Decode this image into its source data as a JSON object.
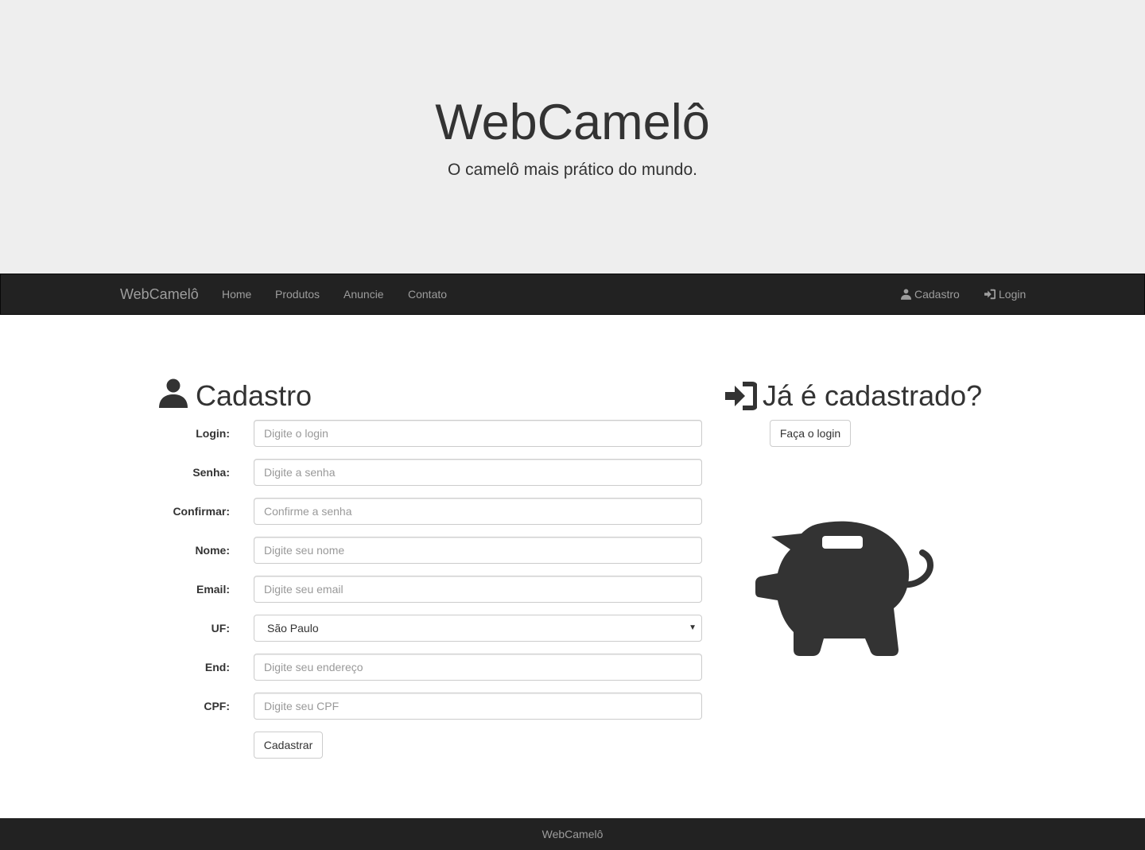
{
  "jumbotron": {
    "title": "WebCamelô",
    "subtitle": "O camelô mais prático do mundo."
  },
  "navbar": {
    "brand": "WebCamelô",
    "links": [
      "Home",
      "Produtos",
      "Anuncie",
      "Contato"
    ],
    "right": {
      "cadastro": "Cadastro",
      "login": "Login"
    }
  },
  "cadastro": {
    "title": "Cadastro",
    "fields": {
      "login": {
        "label": "Login:",
        "placeholder": "Digite o login"
      },
      "senha": {
        "label": "Senha:",
        "placeholder": "Digite a senha"
      },
      "confirmar": {
        "label": "Confirmar:",
        "placeholder": "Confirme a senha"
      },
      "nome": {
        "label": "Nome:",
        "placeholder": "Digite seu nome"
      },
      "email": {
        "label": "Email:",
        "placeholder": "Digite seu email"
      },
      "uf": {
        "label": "UF:",
        "value": "São Paulo"
      },
      "end": {
        "label": "End:",
        "placeholder": "Digite seu endereço"
      },
      "cpf": {
        "label": "CPF:",
        "placeholder": "Digite seu CPF"
      }
    },
    "submit": "Cadastrar"
  },
  "login_panel": {
    "title": "Já é cadastrado?",
    "button": "Faça o login"
  },
  "footer": {
    "text": "WebCamelô"
  },
  "colors": {
    "navbar_bg": "#222222",
    "jumbotron_bg": "#eeeeee",
    "nav_text": "#9d9d9d",
    "icon": "#333333"
  },
  "icons": [
    "user-icon",
    "login-icon",
    "piggy-bank-icon"
  ]
}
